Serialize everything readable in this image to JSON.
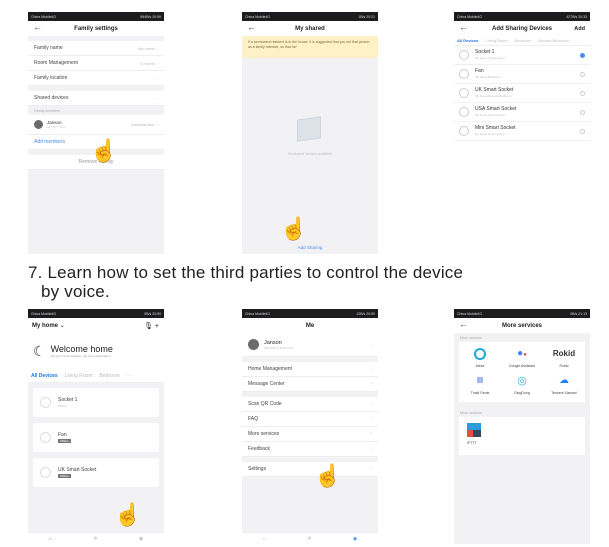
{
  "caption": {
    "line1": "7. Learn how to set the third parties to control the device",
    "line2": "by voice."
  },
  "p1": {
    "status": {
      "carrier": "China Mobile4G",
      "info": "894B/s 20:59"
    },
    "title": "Family settings",
    "rows": [
      {
        "label": "Family name",
        "value": "My home"
      },
      {
        "label": "Room Management",
        "value": "6 rooms"
      },
      {
        "label": "Family location",
        "value": ""
      }
    ],
    "shared": "Shared devices",
    "members_label": "Family members",
    "member": {
      "name": "Janson",
      "email": "va**@***.com",
      "role": "Administrator"
    },
    "add_members": "Add members",
    "remove": "Remove Family"
  },
  "p2": {
    "status": {
      "carrier": "China Mobile4G",
      "info": "1B/s 20:21"
    },
    "title": "My shared",
    "notice": "If a permanent resident is in the house, it is suggested that you set that person as a family member, so that he/",
    "empty": "No shared devices available",
    "add": "Add Sharing"
  },
  "p3": {
    "status": {
      "carrier": "China Mobile4G",
      "info": "427B/s 20:33"
    },
    "title": "Add Sharing Devices",
    "action": "Add",
    "tabs": [
      "All Devices",
      "Living Room",
      "Bedroom",
      "Second Bedroom"
    ],
    "devices": [
      {
        "name": "Socket 1",
        "room": "My home Living Room",
        "selected": true
      },
      {
        "name": "Fan",
        "room": "My home Bedroom",
        "selected": false
      },
      {
        "name": "UK Smart Socket",
        "room": "My home Second Bedroom",
        "selected": false
      },
      {
        "name": "USA Smart Socket",
        "room": "My home Dining Room",
        "selected": false
      },
      {
        "name": "Mini Smart Socket",
        "room": "My home Study Room",
        "selected": false
      }
    ]
  },
  "p4": {
    "status": {
      "carrier": "China Mobile4G",
      "info": "0B/s 20:59"
    },
    "home": "My home",
    "welcome": "Welcome home",
    "welcome_sub": "Set your home location, get more information",
    "tabs": [
      "All Devices",
      "Living Room",
      "Bedroom"
    ],
    "devices": [
      {
        "name": "Socket 1",
        "status": "Offline"
      },
      {
        "name": "Fan",
        "status": "Offline"
      },
      {
        "name": "UK Smart Socket",
        "status": "Offline"
      }
    ]
  },
  "p5": {
    "status": {
      "carrier": "China Mobile4G",
      "info": "12B/s 20:59"
    },
    "title": "Me",
    "user": "Janson",
    "user_sub": "Tap here to find phone",
    "items": [
      "Home Management",
      "Message Center",
      "Scan QR Code",
      "FAQ",
      "More services",
      "Feedback",
      "Settings"
    ]
  },
  "p6": {
    "status": {
      "carrier": "China Mobile4G",
      "info": "0B/s 21:13"
    },
    "title": "More services",
    "section1": "More services",
    "services": [
      {
        "name": "Alexa",
        "color": "#1ba8d9"
      },
      {
        "name": "Google Assistant",
        "color": "#ea4335"
      },
      {
        "name": "Rokid",
        "color": "#333333"
      },
      {
        "name": "Tmall Genie",
        "color": "#3d6fd8"
      },
      {
        "name": "DingDong",
        "color": "#26b3e5"
      },
      {
        "name": "Tencent Xiaowei",
        "color": "#1f86f0"
      }
    ],
    "section2": "More services",
    "ifttt": "IFTTT"
  }
}
